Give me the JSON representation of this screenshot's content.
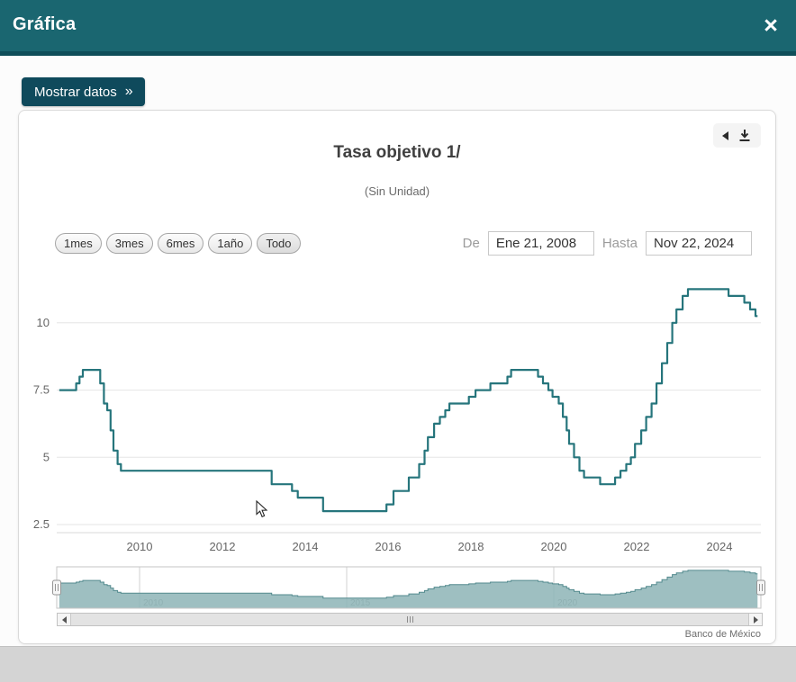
{
  "colors": {
    "header_bg": "#1a6670",
    "header_border": "#0f4e59",
    "accent": "#26757c",
    "navigator_fill": "#8db4b6",
    "navigator_stroke": "#538a8e",
    "button_bg": "#0f4a5c"
  },
  "icons": {
    "close": "×",
    "chevrons": "»",
    "collapse": "left-triangle",
    "download": "download-arrow"
  },
  "header": {
    "title": "Gráfica",
    "close": "×"
  },
  "toolbar": {
    "show_data": "Mostrar datos",
    "chevrons": "»"
  },
  "chart": {
    "title": "Tasa objetivo 1/",
    "subtitle": "(Sin Unidad)",
    "credit": "Banco de México",
    "range_buttons": [
      {
        "label": "1mes"
      },
      {
        "label": "3mes"
      },
      {
        "label": "6mes"
      },
      {
        "label": "1año"
      },
      {
        "label": "Todo"
      }
    ],
    "date_from": {
      "label": "De",
      "value": "Ene 21, 2008"
    },
    "date_to": {
      "label": "Hasta",
      "value": "Nov 22, 2024"
    }
  },
  "chart_data": {
    "type": "line",
    "step": true,
    "title": "Tasa objetivo 1/",
    "subtitle": "(Sin Unidad)",
    "xlabel": "",
    "ylabel": "",
    "xlim": [
      2008.0,
      2025.0
    ],
    "ylim": [
      2.2,
      11.8
    ],
    "yticks": [
      2.5,
      5,
      7.5,
      10
    ],
    "xticks": [
      2010,
      2012,
      2014,
      2016,
      2018,
      2020,
      2022,
      2024
    ],
    "grid": true,
    "legend": false,
    "navigator": {
      "ylim": [
        0,
        12.3
      ],
      "xticks": [
        2010,
        2015,
        2020
      ]
    },
    "series": [
      {
        "name": "Tasa objetivo",
        "points": [
          [
            2008.06,
            7.5
          ],
          [
            2008.47,
            7.75
          ],
          [
            2008.55,
            8.0
          ],
          [
            2008.63,
            8.25
          ],
          [
            2009.05,
            7.75
          ],
          [
            2009.14,
            7.0
          ],
          [
            2009.22,
            6.75
          ],
          [
            2009.3,
            6.0
          ],
          [
            2009.37,
            5.25
          ],
          [
            2009.47,
            4.75
          ],
          [
            2009.55,
            4.5
          ],
          [
            2013.19,
            4.0
          ],
          [
            2013.68,
            3.75
          ],
          [
            2013.82,
            3.5
          ],
          [
            2014.43,
            3.0
          ],
          [
            2015.96,
            3.25
          ],
          [
            2016.13,
            3.75
          ],
          [
            2016.5,
            4.25
          ],
          [
            2016.75,
            4.75
          ],
          [
            2016.88,
            5.25
          ],
          [
            2016.96,
            5.75
          ],
          [
            2017.11,
            6.25
          ],
          [
            2017.25,
            6.5
          ],
          [
            2017.38,
            6.75
          ],
          [
            2017.48,
            7.0
          ],
          [
            2017.95,
            7.25
          ],
          [
            2018.11,
            7.5
          ],
          [
            2018.47,
            7.75
          ],
          [
            2018.88,
            8.0
          ],
          [
            2018.97,
            8.25
          ],
          [
            2019.62,
            8.0
          ],
          [
            2019.74,
            7.75
          ],
          [
            2019.87,
            7.5
          ],
          [
            2019.97,
            7.25
          ],
          [
            2020.12,
            7.0
          ],
          [
            2020.22,
            6.5
          ],
          [
            2020.31,
            6.0
          ],
          [
            2020.37,
            5.5
          ],
          [
            2020.49,
            5.0
          ],
          [
            2020.62,
            4.5
          ],
          [
            2020.73,
            4.25
          ],
          [
            2021.12,
            4.0
          ],
          [
            2021.48,
            4.25
          ],
          [
            2021.61,
            4.5
          ],
          [
            2021.75,
            4.75
          ],
          [
            2021.86,
            5.0
          ],
          [
            2021.96,
            5.5
          ],
          [
            2022.11,
            6.0
          ],
          [
            2022.23,
            6.5
          ],
          [
            2022.36,
            7.0
          ],
          [
            2022.48,
            7.75
          ],
          [
            2022.61,
            8.5
          ],
          [
            2022.74,
            9.25
          ],
          [
            2022.86,
            10.0
          ],
          [
            2022.96,
            10.5
          ],
          [
            2023.11,
            11.0
          ],
          [
            2023.24,
            11.25
          ],
          [
            2024.22,
            11.0
          ],
          [
            2024.6,
            10.75
          ],
          [
            2024.74,
            10.5
          ],
          [
            2024.87,
            10.25
          ],
          [
            2024.92,
            10.25
          ]
        ]
      }
    ]
  }
}
